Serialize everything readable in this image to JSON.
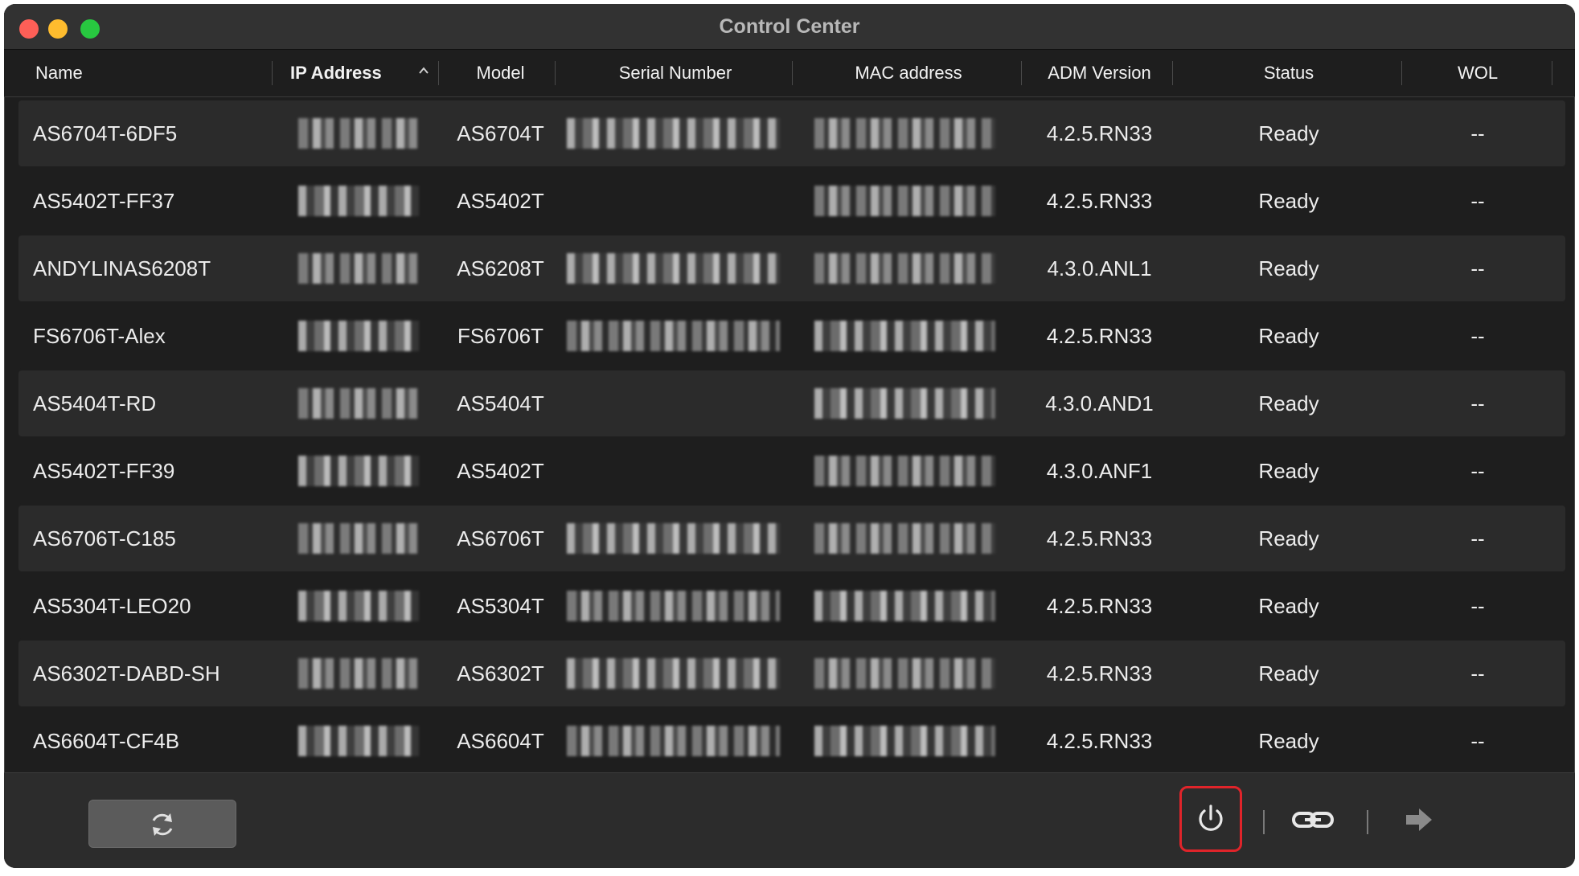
{
  "window": {
    "title": "Control Center"
  },
  "columns": {
    "name": "Name",
    "ip": "IP Address",
    "model": "Model",
    "serial": "Serial Number",
    "mac": "MAC address",
    "adm": "ADM Version",
    "status": "Status",
    "wol": "WOL"
  },
  "devices": [
    {
      "name": "AS6704T-6DF5",
      "model": "AS6704T",
      "adm": "4.2.5.RN33",
      "status": "Ready",
      "wol": "--"
    },
    {
      "name": "AS5402T-FF37",
      "model": "AS5402T",
      "adm": "4.2.5.RN33",
      "status": "Ready",
      "wol": "--"
    },
    {
      "name": "ANDYLINAS6208T",
      "model": "AS6208T",
      "adm": "4.3.0.ANL1",
      "status": "Ready",
      "wol": "--"
    },
    {
      "name": "FS6706T-Alex",
      "model": "FS6706T",
      "adm": "4.2.5.RN33",
      "status": "Ready",
      "wol": "--"
    },
    {
      "name": "AS5404T-RD",
      "model": "AS5404T",
      "adm": "4.3.0.AND1",
      "status": "Ready",
      "wol": "--"
    },
    {
      "name": "AS5402T-FF39",
      "model": "AS5402T",
      "adm": "4.3.0.ANF1",
      "status": "Ready",
      "wol": "--"
    },
    {
      "name": "AS6706T-C185",
      "model": "AS6706T",
      "adm": "4.2.5.RN33",
      "status": "Ready",
      "wol": "--"
    },
    {
      "name": "AS5304T-LEO20",
      "model": "AS5304T",
      "adm": "4.2.5.RN33",
      "status": "Ready",
      "wol": "--"
    },
    {
      "name": "AS6302T-DABD-SH",
      "model": "AS6302T",
      "adm": "4.2.5.RN33",
      "status": "Ready",
      "wol": "--"
    },
    {
      "name": "AS6604T-CF4B",
      "model": "AS6604T",
      "adm": "4.2.5.RN33",
      "status": "Ready",
      "wol": "--"
    }
  ],
  "icons": {
    "sort": "chevron-up-icon",
    "refresh": "refresh-icon",
    "power": "power-icon",
    "link": "link-icon",
    "connect": "arrow-right-icon"
  },
  "colors": {
    "highlight_border": "#e0242a",
    "row_alt": "#2b2b2b",
    "background": "#1e1e1e"
  }
}
